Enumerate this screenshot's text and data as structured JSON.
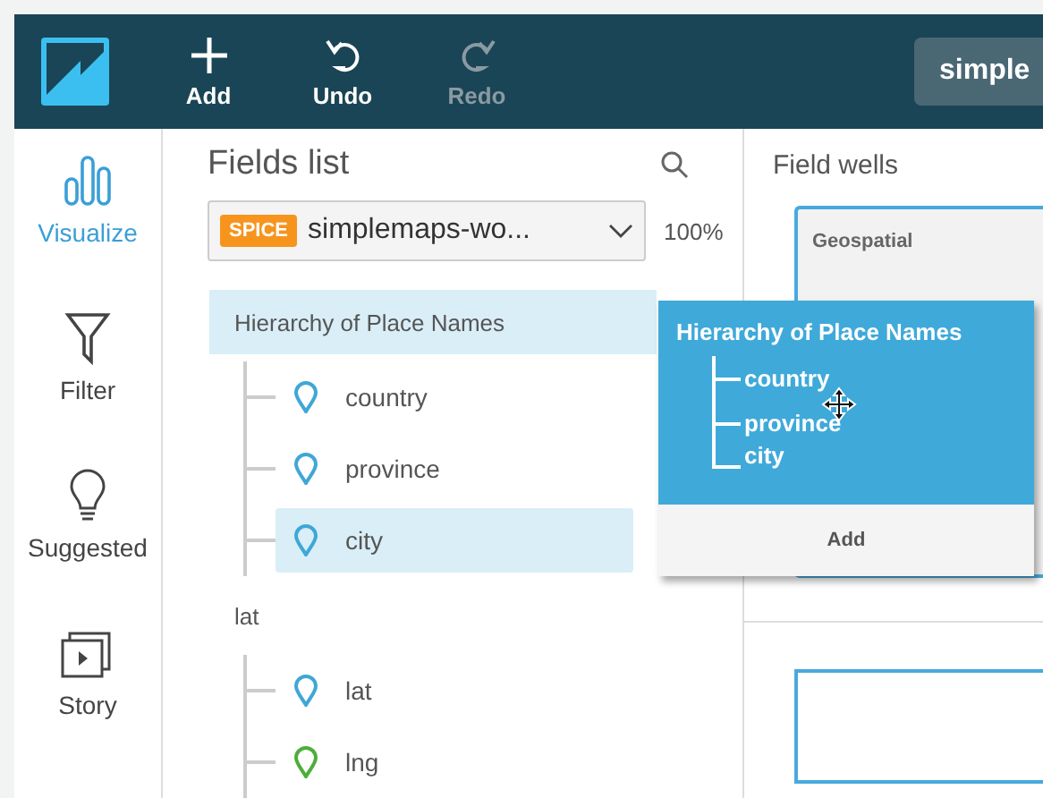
{
  "toolbar": {
    "buttons": [
      {
        "label": "Add",
        "kind": "add",
        "disabled": false
      },
      {
        "label": "Undo",
        "kind": "undo",
        "disabled": false
      },
      {
        "label": "Redo",
        "kind": "redo",
        "disabled": true
      }
    ],
    "analysis_name": "simple"
  },
  "nav": [
    {
      "label": "Visualize",
      "kind": "visualize",
      "selected": true
    },
    {
      "label": "Filter",
      "kind": "filter",
      "selected": false
    },
    {
      "label": "Suggested",
      "kind": "suggested",
      "selected": false
    },
    {
      "label": "Story",
      "kind": "story",
      "selected": false
    }
  ],
  "fields_list": {
    "title": "Fields list",
    "dataset": {
      "badge": "SPICE",
      "name": "simplemaps-wo..."
    },
    "spice_usage": "100%",
    "groups": [
      {
        "label": "Hierarchy of Place Names",
        "selected": true,
        "children": [
          {
            "label": "country",
            "color": "#3fa7d6",
            "selected": false
          },
          {
            "label": "province",
            "color": "#3fa7d6",
            "selected": false
          },
          {
            "label": "city",
            "color": "#3fa7d6",
            "selected": true
          }
        ]
      },
      {
        "label": "lat",
        "selected": false,
        "children": [
          {
            "label": "lat",
            "color": "#3fa7d6",
            "selected": false
          },
          {
            "label": "lng",
            "color": "#4cae3a",
            "selected": false
          }
        ]
      }
    ]
  },
  "field_wells": {
    "title": "Field wells",
    "wells": [
      {
        "label": "Geospatial"
      }
    ]
  },
  "drag_popup": {
    "title": "Hierarchy of Place Names",
    "items": [
      "country",
      "province",
      "city"
    ],
    "action": "Add"
  }
}
